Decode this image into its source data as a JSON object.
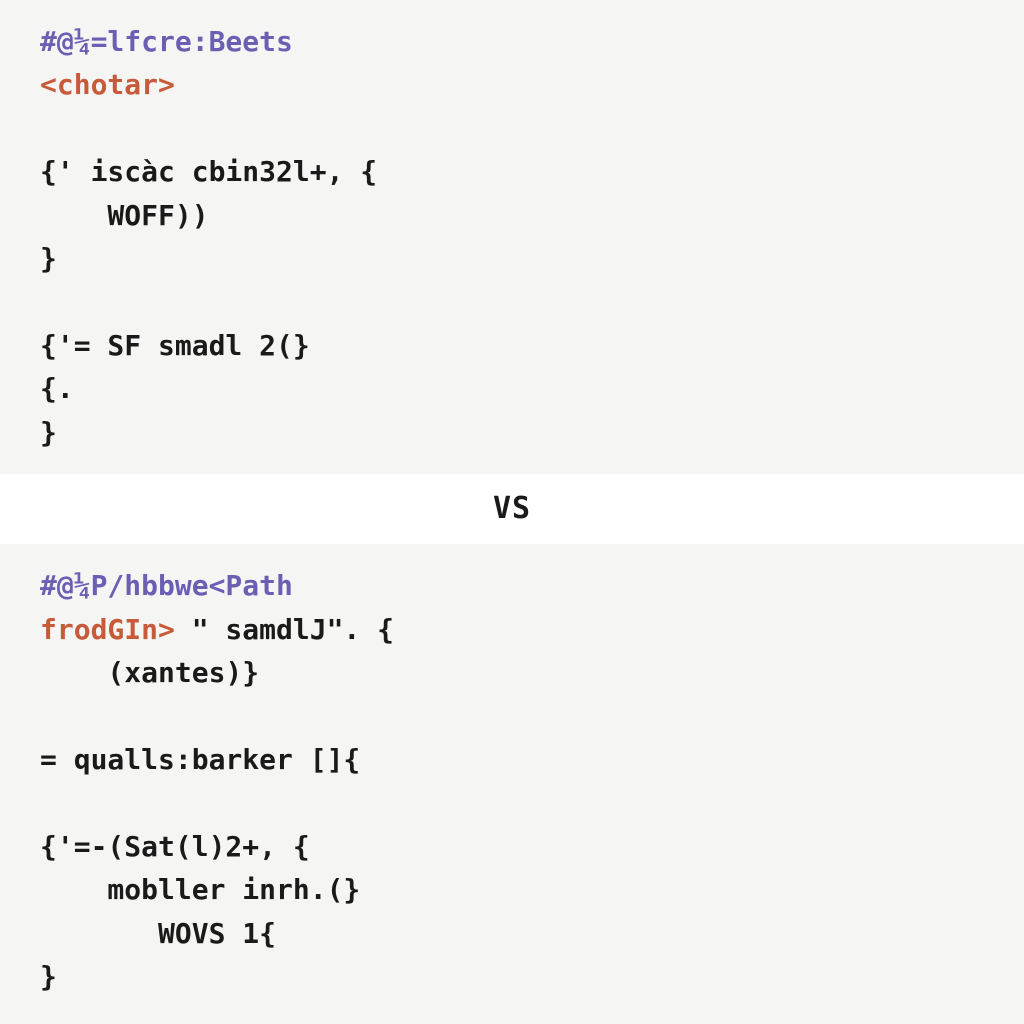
{
  "top": {
    "header_hash": "#@¼=lfcre:Beets",
    "header_tag": "<chotar>",
    "block1_l1": "{' iscàc cbin32l+, {",
    "block1_l2": "    WOFF))",
    "block1_l3": "}",
    "block2_l1": "{'= SF smadl 2(}",
    "block2_l2": "{.",
    "block2_l3": "}"
  },
  "divider": "VS",
  "bottom": {
    "header_hash": "#@¼P/hbbwe<Path",
    "line_kw": "frodGIn>",
    "line_rest": " \" samdlJ\". {",
    "line_indent": "    (xantes)}",
    "eq_line": "= qualls:barker []{",
    "block_l1": "{'=-(Sat(l)2+, {",
    "block_l2": "    mobller inrh.(}",
    "block_l3": "       WOVS 1{",
    "block_l4": "}"
  }
}
